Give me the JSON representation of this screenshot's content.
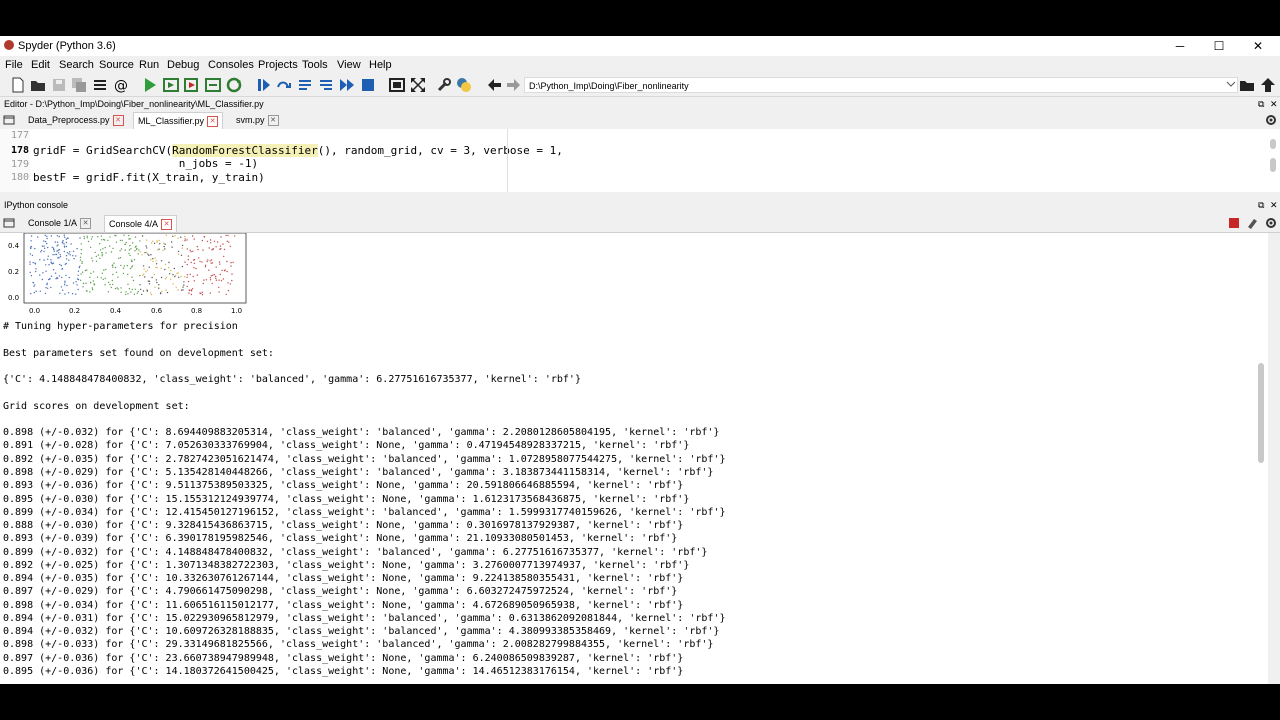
{
  "window": {
    "title": "Spyder (Python 3.6)",
    "controls": [
      "─",
      "☐",
      "✕"
    ]
  },
  "menu": [
    "File",
    "Edit",
    "Search",
    "Source",
    "Run",
    "Debug",
    "Consoles",
    "Projects",
    "Tools",
    "View",
    "Help"
  ],
  "toolbar": {
    "path": "D:\\Python_Imp\\Doing\\Fiber_nonlinearity"
  },
  "editor": {
    "header": "Editor - D:\\Python_Imp\\Doing\\Fiber_nonlinearity\\ML_Classifier.py",
    "tabs": [
      "Data_Preprocess.py",
      "ML_Classifier.py",
      "svm.py"
    ],
    "active_tab": 1,
    "lines": [
      {
        "num": "177",
        "text": ""
      },
      {
        "num": "178",
        "pre": "gridF = GridSearchCV(",
        "hl": "RandomForestClassifier",
        "post": "(), random_grid, cv = 3, verbose = 1,"
      },
      {
        "num": "179",
        "text": "                      n_jobs = -1)"
      },
      {
        "num": "180",
        "text": "bestF = gridF.fit(X_train, y_train)"
      }
    ]
  },
  "console": {
    "header": "IPython console",
    "tabs": [
      "Console 1/A",
      "Console 4/A"
    ],
    "active_tab": 1,
    "plot": {
      "yticks": [
        "0.4",
        "0.2",
        "0.0"
      ],
      "xticks": [
        "0.0",
        "0.2",
        "0.4",
        "0.6",
        "0.8",
        "1.0"
      ]
    },
    "text": [
      "# Tuning hyper-parameters for precision",
      "",
      "Best parameters set found on development set:",
      "",
      "{'C': 4.148848478400832, 'class_weight': 'balanced', 'gamma': 6.27751616735377, 'kernel': 'rbf'}",
      "",
      "Grid scores on development set:",
      "",
      "0.898 (+/-0.032) for {'C': 8.694409883205314, 'class_weight': 'balanced', 'gamma': 2.2080128605804195, 'kernel': 'rbf'}",
      "0.891 (+/-0.028) for {'C': 7.052630333769904, 'class_weight': None, 'gamma': 0.47194548928337215, 'kernel': 'rbf'}",
      "0.892 (+/-0.035) for {'C': 2.7827423051621474, 'class_weight': 'balanced', 'gamma': 1.0728958077544275, 'kernel': 'rbf'}",
      "0.898 (+/-0.029) for {'C': 5.135428140448266, 'class_weight': 'balanced', 'gamma': 3.183873441158314, 'kernel': 'rbf'}",
      "0.893 (+/-0.036) for {'C': 9.511375389503325, 'class_weight': None, 'gamma': 20.591806646885594, 'kernel': 'rbf'}",
      "0.895 (+/-0.030) for {'C': 15.155312124939774, 'class_weight': None, 'gamma': 1.6123173568436875, 'kernel': 'rbf'}",
      "0.899 (+/-0.034) for {'C': 12.415450127196152, 'class_weight': 'balanced', 'gamma': 1.5999317740159626, 'kernel': 'rbf'}",
      "0.888 (+/-0.030) for {'C': 9.328415436863715, 'class_weight': None, 'gamma': 0.3016978137929387, 'kernel': 'rbf'}",
      "0.893 (+/-0.039) for {'C': 6.390178195982546, 'class_weight': None, 'gamma': 21.10933080501453, 'kernel': 'rbf'}",
      "0.899 (+/-0.032) for {'C': 4.148848478400832, 'class_weight': 'balanced', 'gamma': 6.27751616735377, 'kernel': 'rbf'}",
      "0.892 (+/-0.025) for {'C': 1.3071348382722303, 'class_weight': None, 'gamma': 3.2760007713974937, 'kernel': 'rbf'}",
      "0.894 (+/-0.035) for {'C': 10.332630761267144, 'class_weight': None, 'gamma': 9.224138580355431, 'kernel': 'rbf'}",
      "0.897 (+/-0.029) for {'C': 4.790661475090298, 'class_weight': None, 'gamma': 6.603272475972524, 'kernel': 'rbf'}",
      "0.898 (+/-0.034) for {'C': 11.606516115012177, 'class_weight': None, 'gamma': 4.672689050965938, 'kernel': 'rbf'}",
      "0.894 (+/-0.031) for {'C': 15.022930965812979, 'class_weight': 'balanced', 'gamma': 0.6313862092081844, 'kernel': 'rbf'}",
      "0.894 (+/-0.032) for {'C': 10.609726328188835, 'class_weight': 'balanced', 'gamma': 4.380993385358469, 'kernel': 'rbf'}",
      "0.898 (+/-0.033) for {'C': 29.33149681825566, 'class_weight': 'balanced', 'gamma': 2.008282799884355, 'kernel': 'rbf'}",
      "0.897 (+/-0.036) for {'C': 23.660738947989948, 'class_weight': None, 'gamma': 6.240086509839287, 'kernel': 'rbf'}",
      "0.895 (+/-0.036) for {'C': 14.180372641500425, 'class_weight': None, 'gamma': 14.46512383176154, 'kernel': 'rbf'}"
    ]
  },
  "colors": {
    "scatter": [
      "#4c6eb5",
      "#5a9e4b",
      "#d9b44a",
      "#c24a4a",
      "#555555"
    ]
  }
}
